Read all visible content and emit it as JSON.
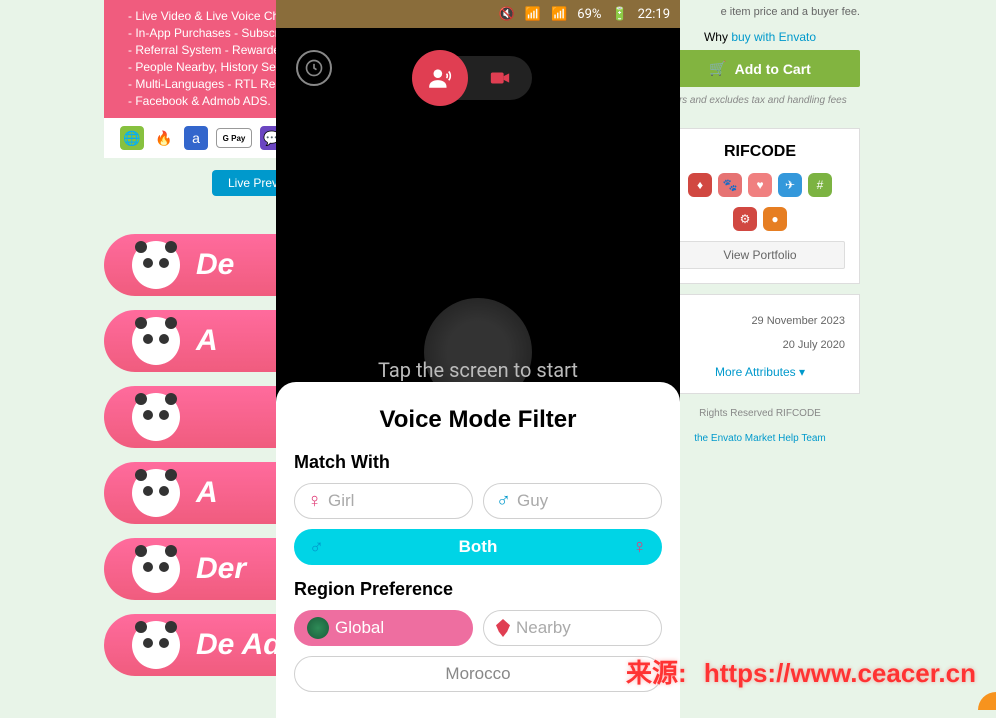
{
  "features": {
    "items": [
      "Live Video & Live Voice Chat",
      "In-App Purchases - Subscriptions",
      "Referral System - Rewarded",
      "People Nearby, History Search",
      "Multi-Languages - RTL Ready",
      "Facebook & Admob ADS."
    ],
    "gpay_label": "G Pay"
  },
  "left": {
    "preview_label": "Live Preview"
  },
  "pink_buttons": {
    "items": [
      {
        "label": "De"
      },
      {
        "label": "A"
      },
      {
        "label": ""
      },
      {
        "label": "A"
      },
      {
        "label": "Der"
      },
      {
        "label": "De Adr"
      }
    ]
  },
  "sidebar": {
    "price_note": "e item price and a buyer fee.",
    "why_buy_prefix": "Why ",
    "why_buy_link": "buy with Envato",
    "add_cart_label": "Add to Cart",
    "tax_note": "ars and excludes tax and handling fees",
    "author_name": "RIFCODE",
    "view_portfolio_label": "View Portfolio",
    "attrs": {
      "date1": "29 November 2023",
      "date2": "20 July 2020",
      "more_label": "More Attributes"
    },
    "copyright": "Rights Reserved RIFCODE",
    "help_contact": "the Envato Market Help Team"
  },
  "phone": {
    "status": {
      "battery_pct": "69%",
      "time": "22:19"
    },
    "tap_text": "Tap the screen to start"
  },
  "sheet": {
    "title": "Voice Mode Filter",
    "match_section": "Match With",
    "girl_label": "Girl",
    "guy_label": "Guy",
    "both_label": "Both",
    "region_section": "Region Preference",
    "global_label": "Global",
    "nearby_label": "Nearby",
    "country_label": "Morocco"
  },
  "watermark": {
    "prefix": "来源:",
    "url": "https://www.ceacer.cn"
  }
}
